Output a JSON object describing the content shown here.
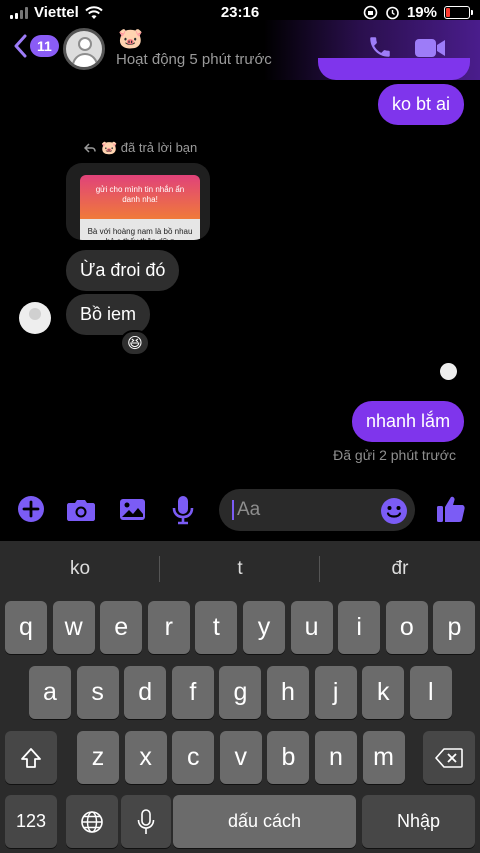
{
  "status_bar": {
    "carrier": "Viettel",
    "time": "23:16",
    "battery": "19%"
  },
  "header": {
    "back_count": "11",
    "contact_name": "🐷",
    "contact_status": "Hoạt động 5 phút trước"
  },
  "chat": {
    "me_1": "ko bt ai",
    "reply_note": "🐷 đã trả lời bạn",
    "quoted_story_top": "gửi cho mình tin nhắn ẩn danh nha!",
    "quoted_story_bottom": "Bà với hoàng nam là bồ nhau hả s thấy thân dữ z",
    "them_1": "Ừa đroi đó",
    "them_2": "Bồ iem",
    "reaction": "😆",
    "me_2": "nhanh lắm",
    "sent_status": "Đã gửi 2 phút trước"
  },
  "composer": {
    "placeholder": "Aa"
  },
  "keyboard": {
    "suggestions": [
      "ko",
      "t",
      "đr"
    ],
    "row1": [
      "q",
      "w",
      "e",
      "r",
      "t",
      "y",
      "u",
      "i",
      "o",
      "p"
    ],
    "row2": [
      "a",
      "s",
      "d",
      "f",
      "g",
      "h",
      "j",
      "k",
      "l"
    ],
    "row3": [
      "z",
      "x",
      "c",
      "v",
      "b",
      "n",
      "m"
    ],
    "numbers_label": "123",
    "space_label": "dấu cách",
    "return_label": "Nhập"
  },
  "colors": {
    "accent": "#7f35ec",
    "icon_accent": "#7b5cf5",
    "incoming_bubble": "#2e2e2e"
  }
}
